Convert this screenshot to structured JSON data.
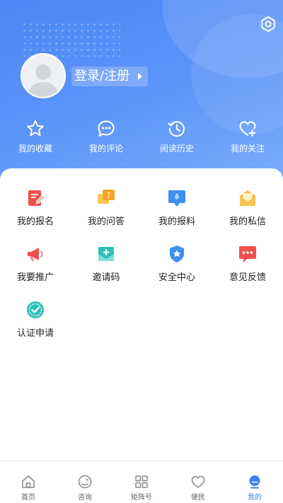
{
  "header": {
    "login_label": "登录/注册",
    "quick_links": [
      {
        "label": "我的收藏",
        "icon": "star-icon"
      },
      {
        "label": "我的评论",
        "icon": "comment-icon"
      },
      {
        "label": "阅读历史",
        "icon": "history-icon"
      },
      {
        "label": "我的关注",
        "icon": "heart-plus-icon"
      }
    ]
  },
  "grid": {
    "items": [
      {
        "label": "我的报名",
        "icon": "signup-icon",
        "color": "#f0504c"
      },
      {
        "label": "我的问答",
        "icon": "qa-icon",
        "color": "#f5a623"
      },
      {
        "label": "我的报料",
        "icon": "report-icon",
        "color": "#3d8ff0"
      },
      {
        "label": "我的私信",
        "icon": "message-icon",
        "color": "#f5b731"
      },
      {
        "label": "我要推广",
        "icon": "megaphone-icon",
        "color": "#f0504c"
      },
      {
        "label": "邀请码",
        "icon": "invite-icon",
        "color": "#2fc0b4"
      },
      {
        "label": "安全中心",
        "icon": "shield-icon",
        "color": "#3d8ff0"
      },
      {
        "label": "意见反馈",
        "icon": "feedback-icon",
        "color": "#f0504c"
      },
      {
        "label": "认证申请",
        "icon": "verify-icon",
        "color": "#2fc0b4"
      }
    ]
  },
  "tabbar": {
    "tabs": [
      {
        "label": "首页",
        "icon": "home-icon"
      },
      {
        "label": "咨询",
        "icon": "consult-icon"
      },
      {
        "label": "矩阵号",
        "icon": "grid-icon"
      },
      {
        "label": "便民",
        "icon": "heart-icon"
      },
      {
        "label": "我的",
        "icon": "profile-icon",
        "active": true
      }
    ]
  },
  "colors": {
    "header_gradient_start": "#4b86f5",
    "header_gradient_end": "#79acfb",
    "accent": "#3d83f2"
  }
}
